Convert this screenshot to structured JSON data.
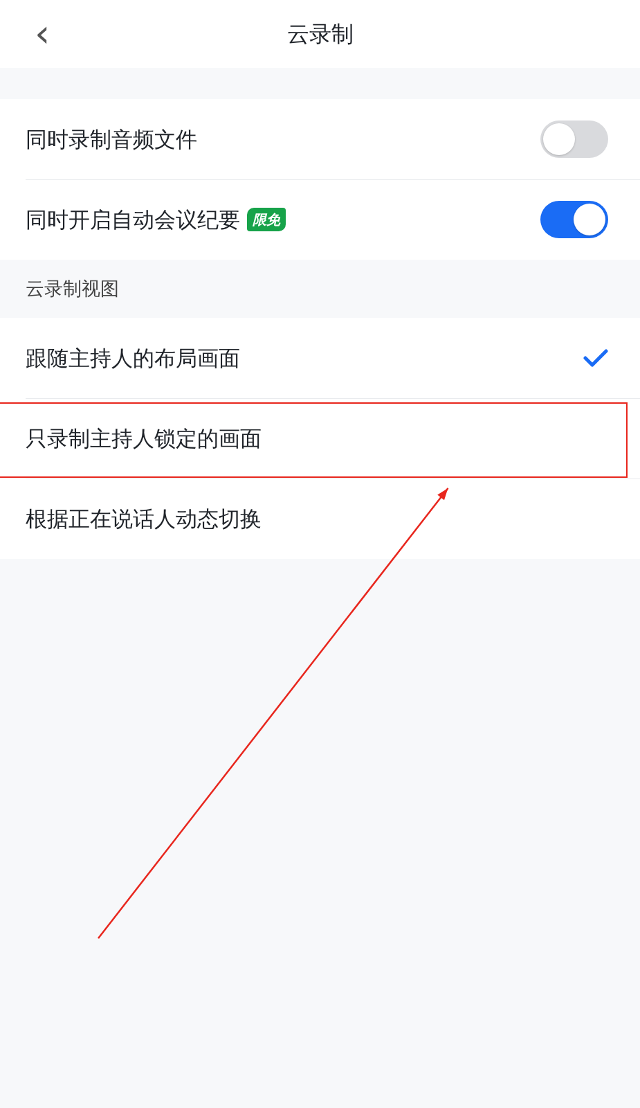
{
  "header": {
    "back": "‹",
    "title": "云录制"
  },
  "settings": [
    {
      "label": "同时录制音频文件",
      "on": false
    },
    {
      "label": "同时开启自动会议纪要",
      "badge": "限免",
      "on": true
    }
  ],
  "section_title": "云录制视图",
  "view_options": [
    {
      "label": "跟随主持人的布局画面",
      "selected": true,
      "highlighted": false
    },
    {
      "label": "只录制主持人锁定的画面",
      "selected": false,
      "highlighted": true
    },
    {
      "label": "根据正在说话人动态切换",
      "selected": false,
      "highlighted": false
    }
  ]
}
